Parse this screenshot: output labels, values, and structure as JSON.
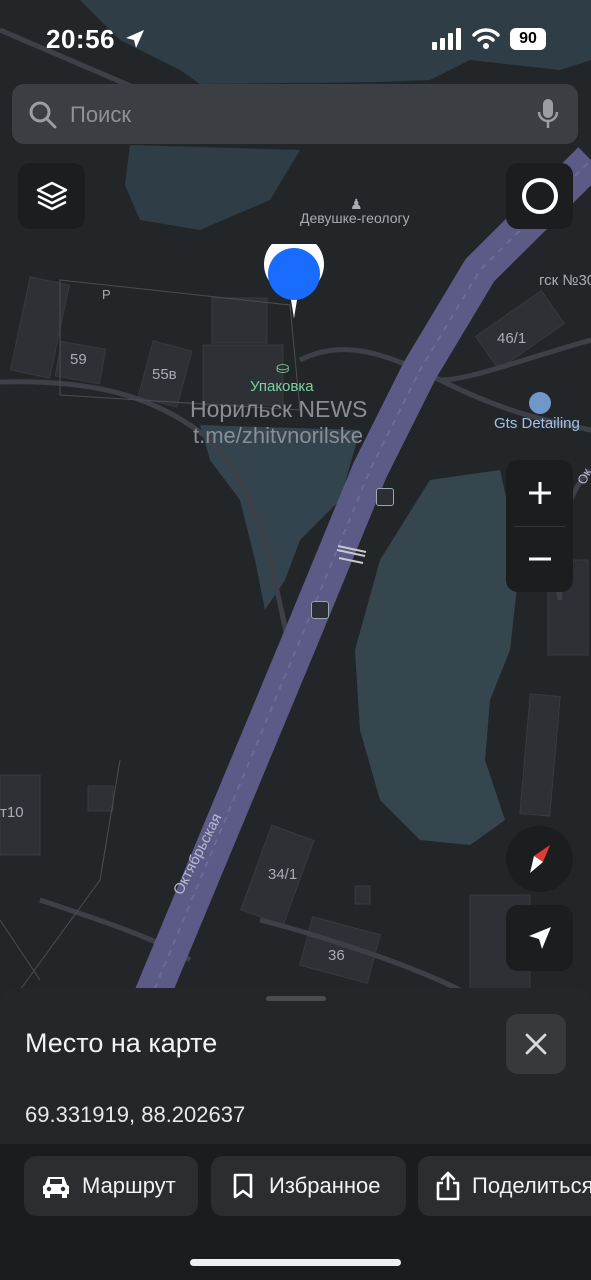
{
  "status_bar": {
    "time": "20:56",
    "battery": "90"
  },
  "search": {
    "placeholder": "Поиск"
  },
  "map": {
    "labels": {
      "monument": "Девушке-геологу",
      "packaging": "Упаковка",
      "watermark_title": "Норильск NEWS",
      "watermark_link": "t.me/zhitvnorilske",
      "gts": "Gts Detailing",
      "gsk": "гск №30",
      "b46": "46/1",
      "b59": "59",
      "b55v": "55в",
      "parking": "P",
      "b10": "т10",
      "b341": "34/1",
      "b36": "36",
      "street": "Октябрьская",
      "street_edge": "Ок"
    },
    "icons": {
      "layers": "layers-icon",
      "compass_ring": "compass-ring-icon",
      "zoom_in": "plus-icon",
      "zoom_out": "minus-icon",
      "north": "north-compass-icon",
      "locate": "location-arrow-icon"
    }
  },
  "sheet": {
    "title": "Место на карте",
    "coordinates": "69.331919, 88.202637",
    "actions": {
      "route": "Маршрут",
      "favorites": "Избранное",
      "share": "Поделиться"
    }
  },
  "colors": {
    "pin": "#1a6cff",
    "road": "#5c5a86",
    "water": "#3a4a55",
    "land": "#232628",
    "sheet": "#252629"
  }
}
